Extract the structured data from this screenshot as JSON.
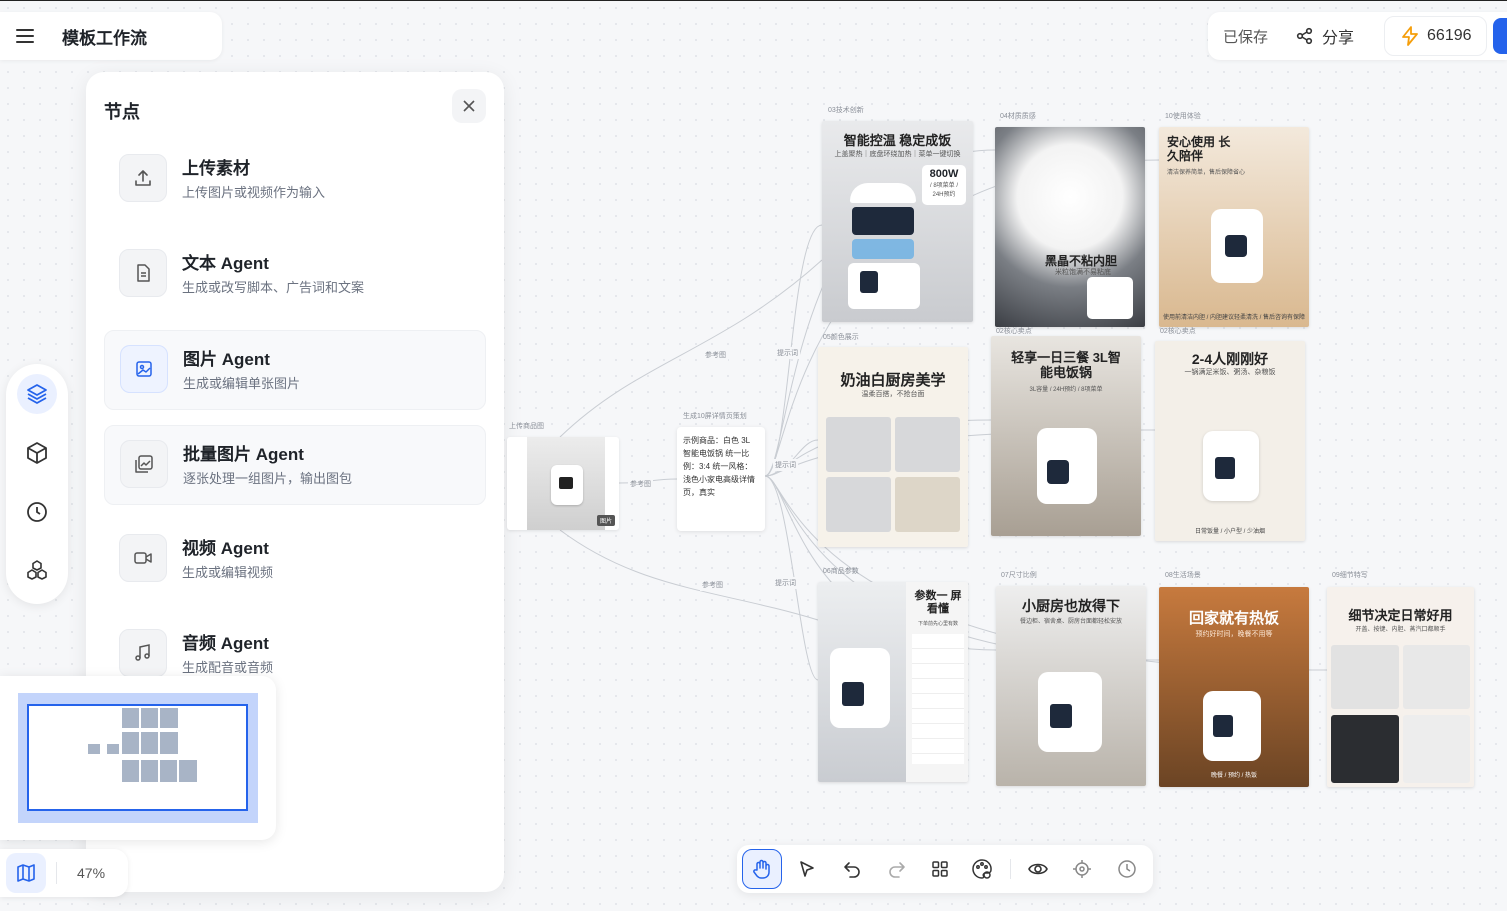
{
  "app": {
    "title": "模板工作流"
  },
  "header": {
    "saved": "已保存",
    "share": "分享",
    "credits": "66196"
  },
  "panel": {
    "title": "节点",
    "items": [
      {
        "title": "上传素材",
        "desc": "上传图片或视频作为输入",
        "icon": "upload-icon"
      },
      {
        "title": "文本 Agent",
        "desc": "生成或改写脚本、广告词和文案",
        "icon": "document-icon"
      },
      {
        "title": "图片 Agent",
        "desc": "生成或编辑单张图片",
        "icon": "image-icon"
      },
      {
        "title": "批量图片 Agent",
        "desc": "逐张处理一组图片，输出图包",
        "icon": "images-icon"
      },
      {
        "title": "视频 Agent",
        "desc": "生成或编辑视频",
        "icon": "video-icon"
      },
      {
        "title": "音频 Agent",
        "desc": "生成配音或音频",
        "icon": "music-icon"
      }
    ]
  },
  "zoom": "47%",
  "canvas": {
    "source": {
      "tag": "上传商品图",
      "badge": "图片"
    },
    "text_node": {
      "tag": "生成10屏详情页策划",
      "content": "示例商品：白色 3L 智能电饭锅 统一比例：3:4 统一风格：浅色小家电高级详情页，真实"
    },
    "edge_labels": {
      "ref": "参考图",
      "prompt": "提示词"
    },
    "cards": [
      {
        "tag": "03技术创新",
        "headline": "智能控温 稳定成饭",
        "sub": "上盖聚热｜底盘环绕加热｜菜单一键切换",
        "badge": "800W",
        "badge_sub": "/ 8项菜单 / 24H预约"
      },
      {
        "tag": "04材质质感",
        "headline": "黑晶不粘内胆",
        "sub": "米粒饱满不易粘底"
      },
      {
        "tag": "10使用体验",
        "headline": "安心使用 长久陪伴",
        "sub": "清洁保养简单，售后保障省心",
        "foot": "使用前清洁内胆 / 内胆建议轻柔清洗 / 售后咨询有保障"
      },
      {
        "tag": "05颜色展示",
        "headline": "奶油白厨房美学",
        "sub": "温柔百搭，不抢台面"
      },
      {
        "tag": "02核心卖点",
        "headline": "轻享一日三餐 3L智能电饭锅",
        "sub": "3L容量 / 24H预约 / 8项菜单"
      },
      {
        "tag": "02核心卖点",
        "headline": "2-4人刚刚好",
        "sub": "一锅满足米饭、粥汤、杂粮饭",
        "foot": "日常饭量 / 小户型 / 少油烟"
      },
      {
        "tag": "06商品参数",
        "headline": "参数一 屏看懂",
        "sub": "下单前先心里有数"
      },
      {
        "tag": "07尺寸比例",
        "headline": "小厨房也放得下",
        "sub": "餐边柜、宿舍桌、厨房台面都轻松安放"
      },
      {
        "tag": "08生活场景",
        "headline": "回家就有热饭",
        "sub": "预约好时间，晚餐不用等",
        "foot": "晚餐 / 预约 / 热饭"
      },
      {
        "tag": "09细节特写",
        "headline": "细节决定日常好用",
        "sub": "开盖、按键、内胆、蒸汽口都顺手"
      }
    ]
  },
  "colors": {
    "accent": "#2563eb",
    "bolt": "#f59e0b"
  }
}
